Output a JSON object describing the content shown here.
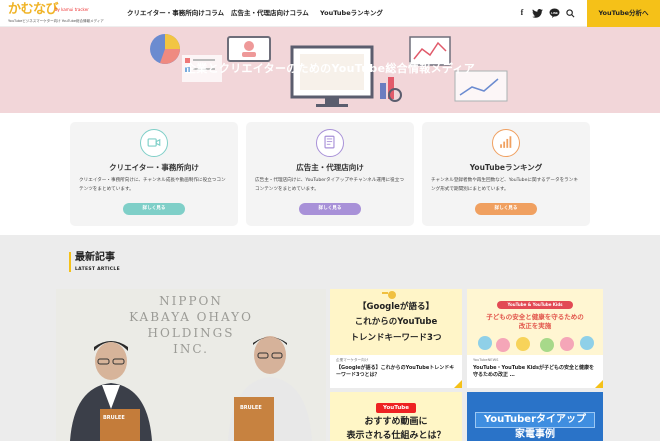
{
  "header": {
    "logo_text": "かむなび",
    "logo_by": "by kamui tracker",
    "logo_sub": "YouTubeビジネスマーケター向け  YouTube総合情報メディア",
    "nav": [
      "クリエイター・事務所向けコラム",
      "広告主・代理店向けコラム",
      "YouTubeランキング"
    ],
    "social_icons": [
      "facebook-icon",
      "twitter-icon",
      "line-icon",
      "search-icon"
    ],
    "cta": "YouTube分析へ"
  },
  "hero": {
    "title": "企業とクリエイターのためのYouTube総合情報メディア"
  },
  "cards": [
    {
      "icon": "video-camera-icon",
      "title": "クリエイター・事務所向け",
      "desc": "クリエイター・事務所向けに、チャンネル成長や動画制作に役立つコンテンツをまとめています。",
      "button": "詳しく見る",
      "color": "#7fcfc8"
    },
    {
      "icon": "document-icon",
      "title": "広告主・代理店向け",
      "desc": "広告主・代理店向けに、YouTuberタイアップやチャンネル運用に役立つコンテンツをまとめています。",
      "button": "詳しく見る",
      "color": "#a891d8"
    },
    {
      "icon": "signal-icon",
      "title": "YouTubeランキング",
      "desc": "チャンネル登録者数や再生回数など、YouTubeに関するデータをランキング形式で期間別にまとめています。",
      "button": "詳しく見る",
      "color": "#f0a060"
    }
  ],
  "latest": {
    "title": "最新記事",
    "subtitle": "LATEST ARTICLE",
    "featured": {
      "sign_lines": [
        "NIPPON",
        "KABAYA OHAYO",
        "HOLDINGS",
        "INC."
      ],
      "box_label": "BRULEE"
    },
    "articles": [
      {
        "thumb_lines": [
          "【Googleが語る】",
          "これからのYouTube",
          "トレンドキーワード3つ"
        ],
        "category": "企業マーケター向け",
        "title": "【Googleが語る】これからのYouTubeトレンドキーワード3つとは？"
      },
      {
        "thumb_tag": "YouTube & YouTube Kids",
        "thumb_lines": [
          "子どもの安全と健康を守るための",
          "改正を実施"
        ],
        "category": "YouTubeNEWS",
        "title": "YouTube・YouTube Kidsが子どもの安全と健康を守るための改正 …"
      },
      {
        "thumb_tag": "YouTube",
        "thumb_lines": [
          "おすすめ動画に",
          "表示される仕組みとは？"
        ]
      },
      {
        "thumb_lines": [
          "YouTuberタイアップ",
          "家電事例"
        ]
      }
    ]
  }
}
